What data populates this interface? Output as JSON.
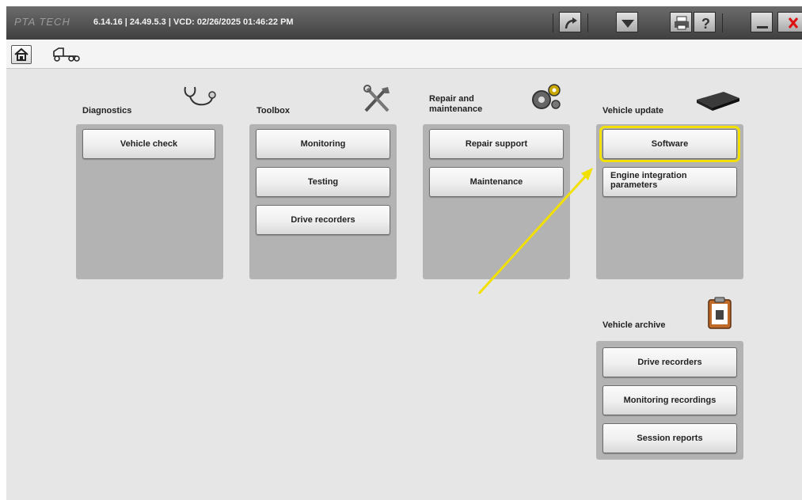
{
  "titlebar": {
    "logo": "PTA TECH",
    "version_text": "6.14.16 | 24.49.5.3 | VCD: 02/26/2025 01:46:22 PM",
    "buttons": [
      "forward-icon",
      "dropdown-arrow-icon",
      "print-icon",
      "help-icon",
      "minimize-icon",
      "close-icon"
    ]
  },
  "toolbar": {
    "icons": [
      "home-icon",
      "truck-icon"
    ]
  },
  "sections": {
    "diagnostics": {
      "title": "Diagnostics",
      "icon": "stethoscope-icon",
      "buttons": [
        "Vehicle check"
      ]
    },
    "toolbox": {
      "title": "Toolbox",
      "icon": "tools-icon",
      "buttons": [
        "Monitoring",
        "Testing",
        "Drive recorders"
      ]
    },
    "repair": {
      "title_line1": "Repair and",
      "title_line2": "maintenance",
      "icon": "gears-icon",
      "buttons": [
        "Repair support",
        "Maintenance"
      ]
    },
    "vehicle_update": {
      "title": "Vehicle update",
      "icon": "ecu-module-icon",
      "buttons": [
        "Software",
        "Engine integration",
        "parameters"
      ]
    },
    "vehicle_archive": {
      "title": "Vehicle archive",
      "icon": "clipboard-icon",
      "buttons": [
        "Drive recorders",
        "Monitoring recordings",
        "Session reports"
      ]
    }
  },
  "annotation": {
    "highlight_color": "#f2e000",
    "arrow_color": "#f2e000"
  }
}
